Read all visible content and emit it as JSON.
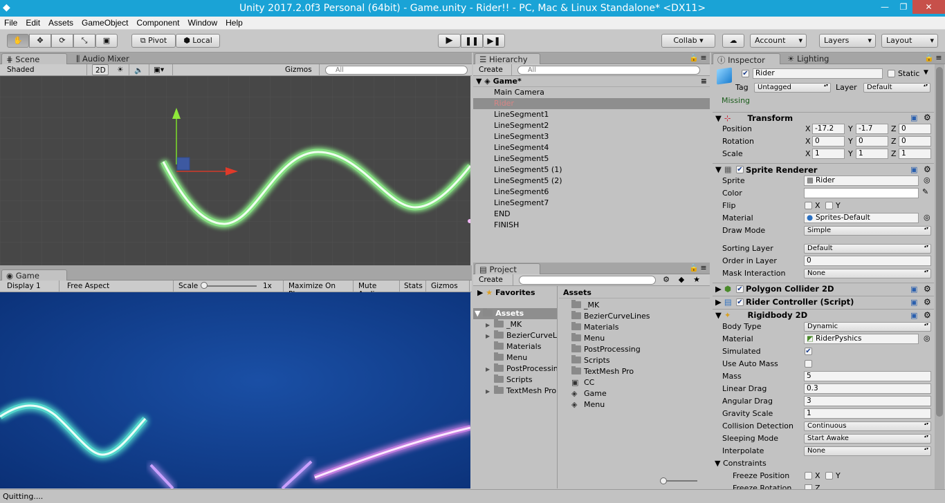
{
  "window": {
    "title": "Unity 2017.2.0f3 Personal (64bit) - Game.unity - Rider!! - PC, Mac & Linux Standalone* <DX11>",
    "minimize": "—",
    "maximize": "❐",
    "close": "✕"
  },
  "menu": [
    "File",
    "Edit",
    "Assets",
    "GameObject",
    "Component",
    "Window",
    "Help"
  ],
  "toolbar": {
    "pivot": "Pivot",
    "local": "Local",
    "collab": "Collab ▾",
    "account": "Account",
    "layers": "Layers",
    "layout": "Layout"
  },
  "scene": {
    "tab": "Scene",
    "tab2": "Audio Mixer",
    "shaded": "Shaded",
    "mode2d": "2D",
    "gizmos": "Gizmos",
    "search": "All"
  },
  "game": {
    "tab": "Game",
    "display": "Display 1",
    "aspect": "Free Aspect",
    "scale_label": "Scale",
    "scale_value": "1x",
    "maximize": "Maximize On Play",
    "mute": "Mute Audio",
    "stats": "Stats",
    "gizmos": "Gizmos"
  },
  "hierarchy": {
    "tab": "Hierarchy",
    "create": "Create",
    "search": "All",
    "scene": "Game*",
    "items": [
      "Main Camera",
      "Rider",
      "LineSegment1",
      "LineSegment2",
      "LineSegment3",
      "LineSegment4",
      "LineSegment5",
      "LineSegment5 (1)",
      "LineSegment5 (2)",
      "LineSegment6",
      "LineSegment7",
      "END",
      "FINISH"
    ],
    "selected_index": 1
  },
  "project": {
    "tab": "Project",
    "create": "Create",
    "favorites": "Favorites",
    "assets": "Assets",
    "tree": [
      "_MK",
      "BezierCurveL",
      "Materials",
      "Menu",
      "PostProcessin",
      "Scripts",
      "TextMesh Pro"
    ],
    "tree_expandable": [
      true,
      true,
      false,
      false,
      true,
      false,
      true
    ],
    "assets_title": "Assets",
    "folders": [
      "_MK",
      "BezierCurveLines",
      "Materials",
      "Menu",
      "PostProcessing",
      "Scripts",
      "TextMesh Pro"
    ],
    "files": [
      "CC",
      "Game",
      "Menu"
    ]
  },
  "inspector": {
    "tab": "Inspector",
    "tab2": "Lighting",
    "object_name": "Rider",
    "static": "Static",
    "tag_label": "Tag",
    "tag": "Untagged",
    "layer_label": "Layer",
    "layer": "Default",
    "missing": "Missing",
    "transform": {
      "title": "Transform",
      "position_label": "Position",
      "rotation_label": "Rotation",
      "scale_label": "Scale",
      "position": {
        "x": "-17.2",
        "y": "-1.7",
        "z": "0"
      },
      "rotation": {
        "x": "0",
        "y": "0",
        "z": "0"
      },
      "scale": {
        "x": "1",
        "y": "1",
        "z": "1"
      }
    },
    "sprite_renderer": {
      "title": "Sprite Renderer",
      "sprite_label": "Sprite",
      "sprite": "Rider",
      "color_label": "Color",
      "flip_label": "Flip",
      "material_label": "Material",
      "material": "Sprites-Default",
      "draw_mode_label": "Draw Mode",
      "draw_mode": "Simple",
      "sorting_layer_label": "Sorting Layer",
      "sorting_layer": "Default",
      "order_label": "Order in Layer",
      "order": "0",
      "mask_label": "Mask Interaction",
      "mask": "None"
    },
    "polygon_collider": "Polygon Collider 2D",
    "rider_controller": "Rider Controller (Script)",
    "rigidbody": {
      "title": "Rigidbody 2D",
      "body_type_label": "Body Type",
      "body_type": "Dynamic",
      "material_label": "Material",
      "material": "RiderPyshics",
      "simulated_label": "Simulated",
      "simulated": true,
      "auto_mass_label": "Use Auto Mass",
      "auto_mass": false,
      "mass_label": "Mass",
      "mass": "5",
      "linear_drag_label": "Linear Drag",
      "linear_drag": "0.3",
      "angular_drag_label": "Angular Drag",
      "angular_drag": "3",
      "gravity_label": "Gravity Scale",
      "gravity": "1",
      "collision_label": "Collision Detection",
      "collision": "Continuous",
      "sleeping_label": "Sleeping Mode",
      "sleeping": "Start Awake",
      "interpolate_label": "Interpolate",
      "interpolate": "None",
      "constraints_label": "Constraints",
      "freeze_pos_label": "Freeze Position",
      "freeze_rot_label": "Freeze Rotation"
    },
    "axis": {
      "x": "X",
      "y": "Y",
      "z": "Z"
    }
  },
  "status": "Quitting....",
  "colors": {
    "title_bar": "#1aa3d6",
    "scene_bg": "#474747",
    "game_bg": "#0d3d8a",
    "neon_green": "#9cf79a",
    "neon_cyan": "#a8f7e8",
    "neon_pink": "#f0b8f5",
    "selection": "#d88585"
  }
}
